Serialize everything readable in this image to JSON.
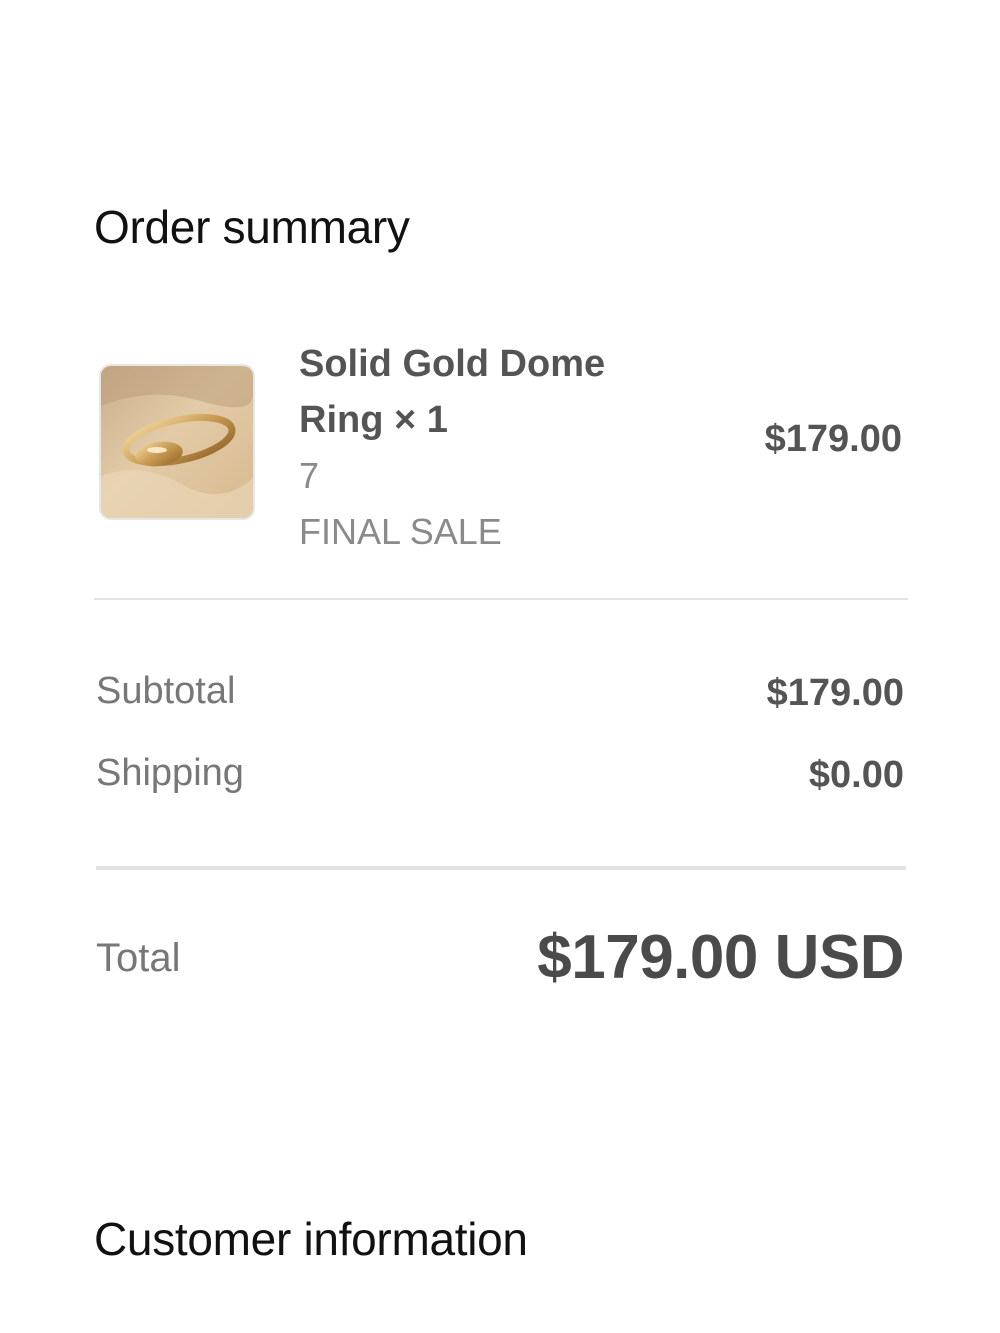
{
  "order_summary": {
    "title": "Order summary",
    "line_item": {
      "name": "Solid Gold Dome Ring × 1",
      "variant": "7",
      "note": "FINAL SALE",
      "price": "$179.00",
      "image": "gold-dome-ring-product-photo"
    },
    "subtotal": {
      "label": "Subtotal",
      "value": "$179.00"
    },
    "shipping": {
      "label": "Shipping",
      "value": "$0.00"
    },
    "total": {
      "label": "Total",
      "value": "$179.00 USD"
    }
  },
  "customer_information": {
    "title": "Customer information"
  },
  "colors": {
    "background": "#ffffff",
    "heading": "#111111",
    "strong_text": "#545454",
    "muted_text": "#8a8a8a",
    "divider": "#e3e3e3"
  }
}
